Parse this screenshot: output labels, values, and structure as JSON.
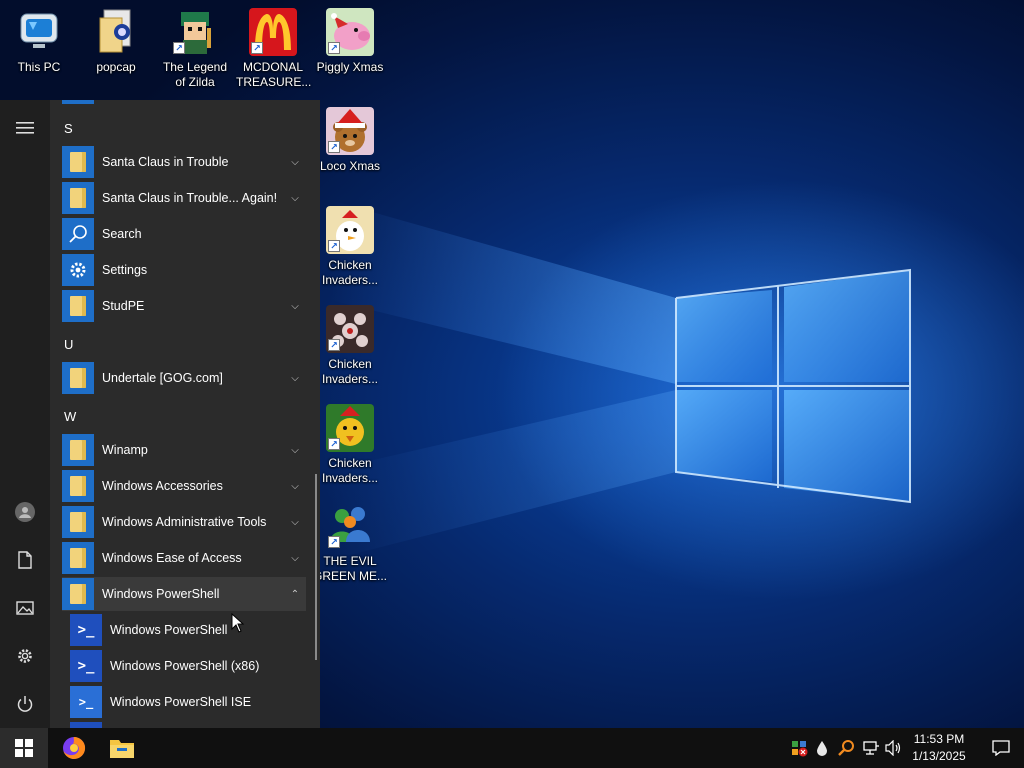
{
  "desktop": {
    "icons": [
      {
        "label": "This PC",
        "icon": "this-pc-icon"
      },
      {
        "label": "popcap",
        "icon": "folder-document-icon"
      },
      {
        "label": "The Legend of Zilda",
        "icon": "game-shortcut-icon"
      },
      {
        "label": "MCDONAL TREASURE...",
        "icon": "mcdonalds-logo-icon"
      },
      {
        "label": "Piggly Xmas",
        "icon": "pig-game-icon"
      },
      {
        "label": "Loco Xmas",
        "icon": "teddy-bear-santa-icon"
      },
      {
        "label": "Chicken Invaders...",
        "icon": "chicken-invaders-icon"
      },
      {
        "label": "Chicken Invaders...",
        "icon": "chicken-invaders-icon"
      },
      {
        "label": "Chicken Invaders...",
        "icon": "chicken-invaders-icon"
      },
      {
        "label": "THE EVIL GREEN ME...",
        "icon": "messenger-people-icon"
      }
    ]
  },
  "start_menu": {
    "rail": {
      "hamburger": "hamburger-icon",
      "user": "user-avatar-icon",
      "documents": "document-icon",
      "pictures": "pictures-icon",
      "settings": "gear-icon",
      "power": "power-icon"
    },
    "letters": {
      "s": "S",
      "u": "U",
      "w": "W"
    },
    "apps": {
      "santa_claus": "Santa Claus in Trouble",
      "santa_claus_again": "Santa Claus in Trouble... Again!",
      "search": "Search",
      "settings": "Settings",
      "studpe": "StudPE",
      "undertale": "Undertale [GOG.com]",
      "winamp": "Winamp",
      "win_accessories": "Windows Accessories",
      "win_admin_tools": "Windows Administrative Tools",
      "win_ease": "Windows Ease of Access",
      "win_powershell_folder": "Windows PowerShell",
      "ps": "Windows PowerShell",
      "ps_x86": "Windows PowerShell (x86)",
      "ps_ise": "Windows PowerShell ISE"
    }
  },
  "taskbar": {
    "pinned": [
      "firefox-icon",
      "file-explorer-icon"
    ],
    "tray": [
      "security-alert-icon",
      "water-drop-icon",
      "search-tool-icon",
      "network-icon",
      "volume-icon"
    ],
    "clock": {
      "time": "11:53 PM",
      "date": "1/13/2025"
    },
    "notification": "action-center-icon"
  },
  "colors": {
    "tile_blue": "#1e6ec8",
    "menu_bg": "#2b2b2b",
    "taskbar_bg": "#101010"
  }
}
